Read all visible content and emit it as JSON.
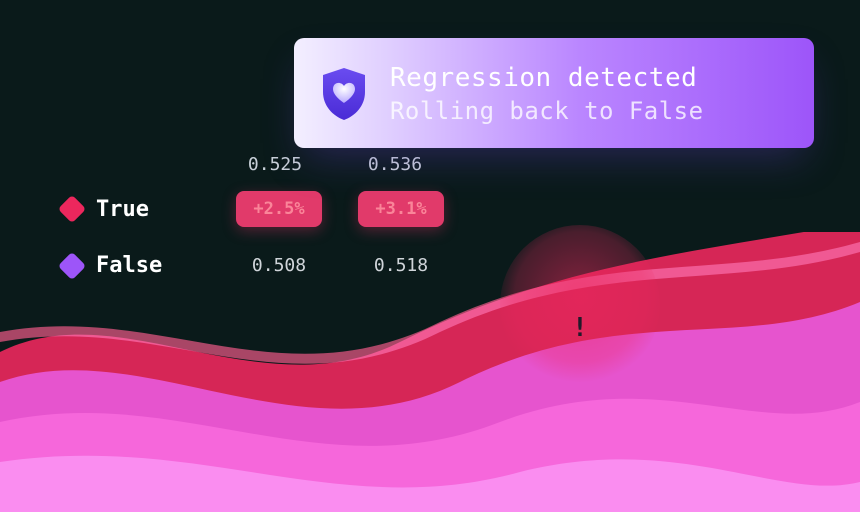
{
  "notification": {
    "title": "Regression detected",
    "subtitle": "Rolling back to False"
  },
  "columns": {
    "c1": "0.525",
    "c2": "0.536"
  },
  "rows": {
    "true_label": "True",
    "false_label": "False",
    "true_values": {
      "c1": "+2.5%",
      "c2": "+3.1%"
    },
    "false_values": {
      "c1": "0.508",
      "c2": "0.518"
    }
  },
  "alert": {
    "bang": "!"
  },
  "colors": {
    "true_color": "#ec275d",
    "false_color": "#9d55f9"
  }
}
